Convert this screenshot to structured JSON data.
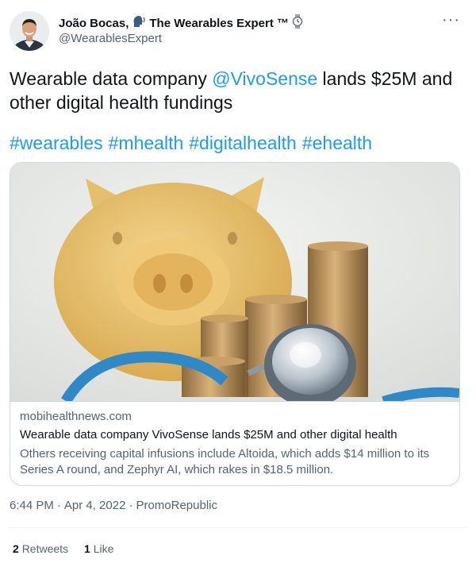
{
  "author": {
    "display_name": "João Bocas,",
    "title_suffix": "The Wearables Expert ™",
    "handle": "@WearablesExpert",
    "avatar_icon": "person-avatar",
    "speaking_icon": "speaking-head-icon",
    "watch_icon": "watch-icon"
  },
  "more_menu": "···",
  "tweet": {
    "text_before": "Wearable data company ",
    "mention": "@VivoSense",
    "text_after": " lands $25M and other digital health fundings",
    "hashtags": [
      "#wearables",
      "#mhealth",
      "#digitalhealth",
      "#ehealth"
    ]
  },
  "card": {
    "domain": "mobihealthnews.com",
    "title": "Wearable data company VivoSense lands $25M and other digital health",
    "description": "Others receiving capital infusions include Altoida, which adds $14 million to its Series A round, and Zephyr AI, which rakes in $18.5 million.",
    "image_subject": "piggy-bank-coins-stethoscope"
  },
  "meta": {
    "time": "6:44 PM",
    "dot1": "·",
    "date": "Apr 4, 2022",
    "dot2": "·",
    "source": "PromoRepublic"
  },
  "stats": {
    "retweets_count": "2",
    "retweets_label": "Retweets",
    "likes_count": "1",
    "likes_label": "Like"
  },
  "colors": {
    "link": "#1d9bf0",
    "secondary_text": "#536471",
    "primary_text": "#0f1419",
    "border": "#cfd9de"
  }
}
